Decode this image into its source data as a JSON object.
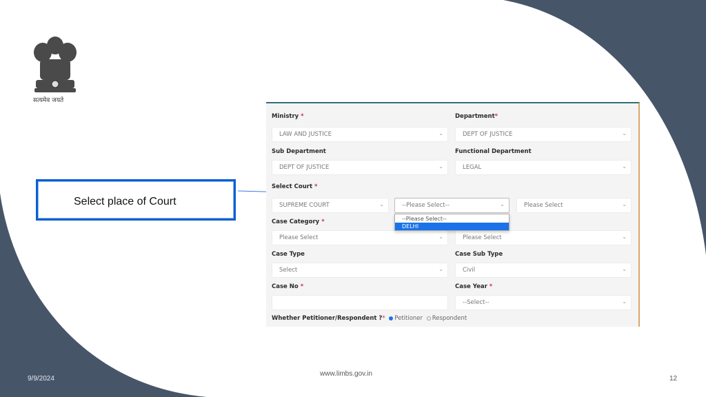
{
  "colors": {
    "background_dark": "#475569",
    "accent": "#0a5fd0",
    "highlight": "#1a73e8",
    "required": "#c8334a"
  },
  "emblem": {
    "icon": "national-emblem-icon",
    "motto": "सत्यमेव जयते"
  },
  "callout": {
    "text": "Select place of Court"
  },
  "form": {
    "ministry": {
      "label": "Ministry",
      "required": "*",
      "value": "LAW AND JUSTICE"
    },
    "department": {
      "label": "Department",
      "required": "*",
      "value": "DEPT OF JUSTICE"
    },
    "sub_department": {
      "label": "Sub Department",
      "value": "DEPT OF JUSTICE"
    },
    "functional_department": {
      "label": "Functional Department",
      "value": "LEGAL"
    },
    "select_court": {
      "label": "Select Court",
      "required": "*",
      "court_value": "SUPREME COURT",
      "place_value": "--Please Select--",
      "third_value": "Please Select",
      "dropdown_options": [
        "--Please Select--",
        "DELHI"
      ],
      "highlighted_option": "DELHI"
    },
    "case_category": {
      "label": "Case Category",
      "required": "*",
      "value": "Please Select",
      "second_value": "Please Select"
    },
    "case_type": {
      "label": "Case Type",
      "value": "Select"
    },
    "case_sub_type": {
      "label": "Case Sub Type",
      "value": "Civil"
    },
    "case_no": {
      "label": "Case No",
      "required": "*",
      "value": ""
    },
    "case_year": {
      "label": "Case Year",
      "required": "*",
      "value": "--Select--"
    },
    "petitioner_respondent": {
      "question": "Whether Petitioner/Respondent ?",
      "required": "*",
      "options": [
        "Petitioner",
        "Respondent"
      ],
      "selected": "Petitioner"
    }
  },
  "footer": {
    "date": "9/9/2024",
    "url": "www.limbs.gov.in",
    "page": "12"
  }
}
